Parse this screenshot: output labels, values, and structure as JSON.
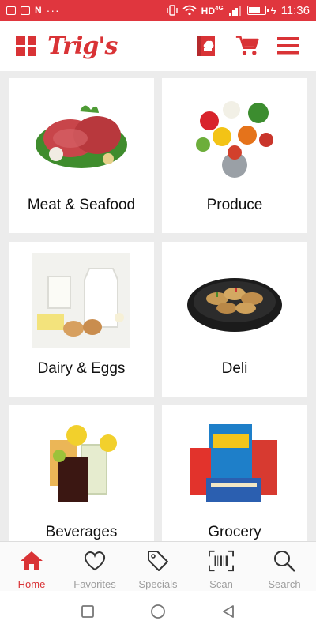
{
  "status_bar": {
    "left_badge": "N",
    "network": "HD",
    "network_sub": "4G",
    "time": "11:36"
  },
  "header": {
    "logo_text": "Trig's"
  },
  "categories": [
    {
      "label": "Meat & Seafood"
    },
    {
      "label": "Produce"
    },
    {
      "label": "Dairy & Eggs"
    },
    {
      "label": "Deli"
    },
    {
      "label": "Beverages"
    },
    {
      "label": "Grocery"
    }
  ],
  "bottom_nav": [
    {
      "label": "Home",
      "icon": "home-icon",
      "active": true
    },
    {
      "label": "Favorites",
      "icon": "heart-icon"
    },
    {
      "label": "Specials",
      "icon": "tag-icon"
    },
    {
      "label": "Scan",
      "icon": "barcode-icon"
    },
    {
      "label": "Search",
      "icon": "search-icon"
    }
  ],
  "colors": {
    "accent": "#d93336",
    "status_bar": "#e0363e",
    "inactive": "#9e9e9e"
  }
}
